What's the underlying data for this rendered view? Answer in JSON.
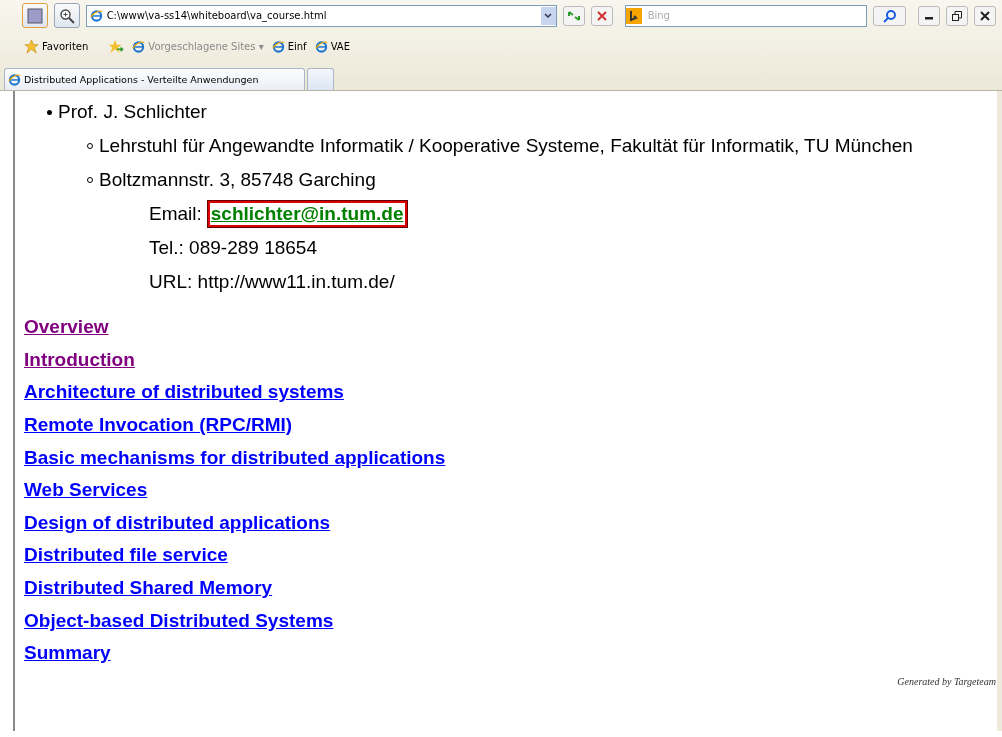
{
  "address_bar": {
    "value": "C:\\www\\va-ss14\\whiteboard\\va_course.html"
  },
  "search": {
    "placeholder": "Bing"
  },
  "favorites_bar": {
    "favorites_label": "Favoriten",
    "items": [
      {
        "label": "Vorgeschlagene Sites ▾",
        "disabled": true
      },
      {
        "label": "Einf",
        "disabled": false
      },
      {
        "label": "VAE",
        "disabled": false
      }
    ]
  },
  "tabs": [
    {
      "label": "Distributed Applications - Verteilte Anwendungen",
      "selected": true
    },
    {
      "selected": false
    }
  ],
  "contact": {
    "name": "Prof. J. Schlichter",
    "details": [
      "Lehrstuhl für Angewandte Informatik / Kooperative Systeme, Fakultät für Informatik, TU München",
      "Boltzmannstr. 3, 85748 Garching"
    ],
    "email_label": "Email:",
    "email": "schlichter@in.tum.de",
    "phone": "Tel.: 089-289 18654",
    "url": "URL: http://www11.in.tum.de/"
  },
  "links": [
    {
      "label": "Overview",
      "visited": true
    },
    {
      "label": "Introduction",
      "visited": true
    },
    {
      "label": "Architecture of distributed systems",
      "visited": false
    },
    {
      "label": "Remote Invocation (RPC/RMI)",
      "visited": false
    },
    {
      "label": "Basic mechanisms for distributed applications",
      "visited": false
    },
    {
      "label": "Web Services",
      "visited": false
    },
    {
      "label": "Design of distributed applications",
      "visited": false
    },
    {
      "label": "Distributed file service",
      "visited": false
    },
    {
      "label": "Distributed Shared Memory",
      "visited": false
    },
    {
      "label": "Object-based Distributed Systems",
      "visited": false
    },
    {
      "label": "Summary",
      "visited": false
    }
  ],
  "footer": "Generated by Targeteam"
}
